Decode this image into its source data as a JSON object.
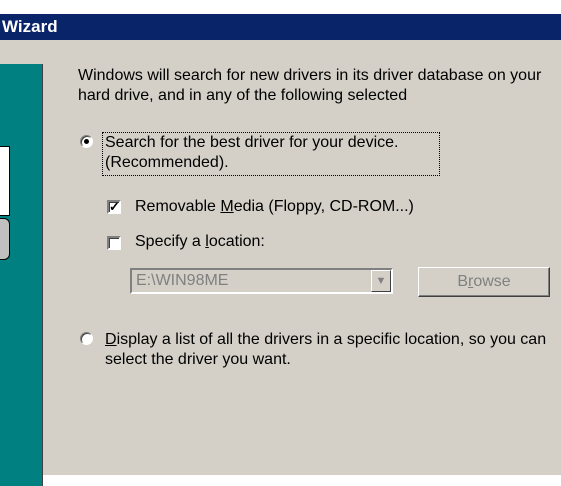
{
  "window": {
    "title": "Wizard"
  },
  "intro_text": "Windows will search for new drivers in its driver database on your hard drive, and in any of the following selected",
  "options": {
    "search_best": {
      "label": "Search for the best driver for your device. (Recommended).",
      "selected": true
    },
    "removable_media": {
      "label_pre": "Removable ",
      "label_ul": "M",
      "label_post": "edia (Floppy, CD-ROM...)",
      "checked": true
    },
    "specify_location": {
      "label_pre": "Specify a ",
      "label_ul": "l",
      "label_post": "ocation:",
      "checked": false
    },
    "location_value": "E:\\WIN98ME",
    "browse_label_pre": "B",
    "browse_label_ul": "r",
    "browse_label_post": "owse",
    "display_list": {
      "label_ul": "D",
      "label_post": "isplay a list of all the drivers in a specific location, so you can select the driver you want.",
      "selected": false
    }
  },
  "colors": {
    "titlebar": "#0a246a",
    "panel": "#d4d0c8",
    "side_banner": "#008080"
  }
}
